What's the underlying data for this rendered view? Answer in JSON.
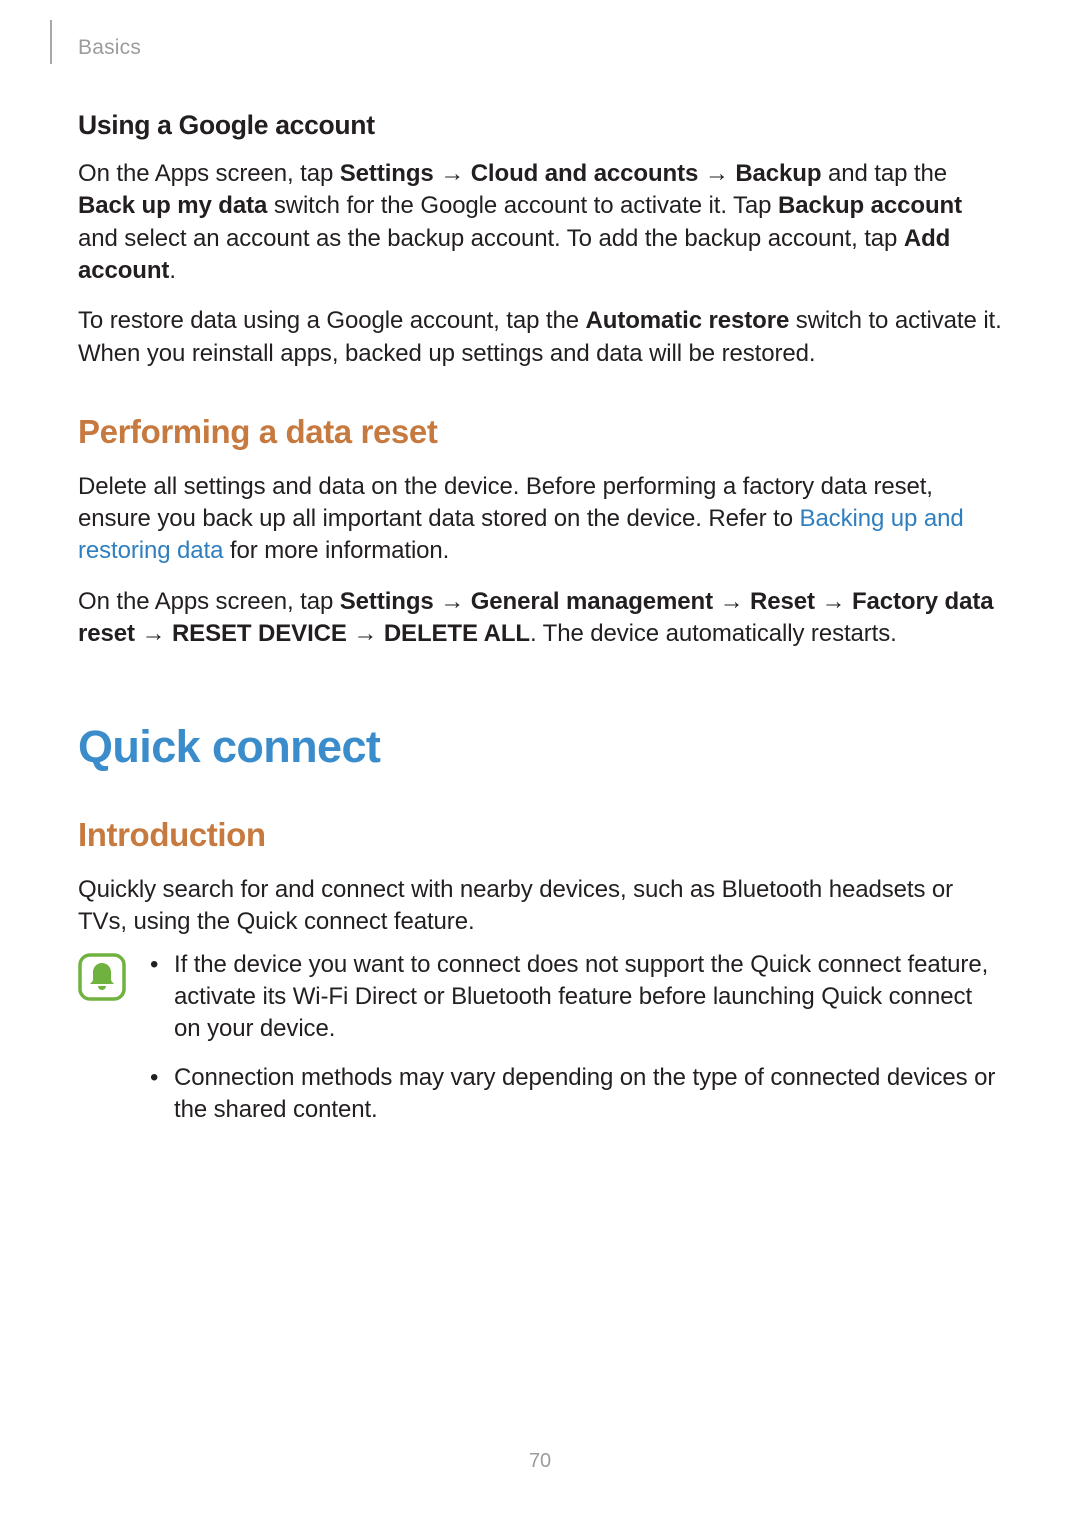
{
  "header": {
    "breadcrumb": "Basics"
  },
  "googleAccount": {
    "heading": "Using a Google account",
    "p1_parts": {
      "t0": "On the Apps screen, tap ",
      "b1": "Settings",
      "a1": " → ",
      "b2": "Cloud and accounts",
      "a2": " → ",
      "b3": "Backup",
      "t1": " and tap the ",
      "b4": "Back up my data",
      "t2": " switch for the Google account to activate it. Tap ",
      "b5": "Backup account",
      "t3": " and select an account as the backup account. To add the backup account, tap ",
      "b6": "Add account",
      "t4": "."
    },
    "p2_parts": {
      "t0": "To restore data using a Google account, tap the ",
      "b1": "Automatic restore",
      "t1": " switch to activate it. When you reinstall apps, backed up settings and data will be restored."
    }
  },
  "dataReset": {
    "heading": "Performing a data reset",
    "p1_parts": {
      "t0": "Delete all settings and data on the device. Before performing a factory data reset, ensure you back up all important data stored on the device. Refer to ",
      "link": "Backing up and restoring data",
      "t1": " for more information."
    },
    "p2_parts": {
      "t0": "On the Apps screen, tap ",
      "b1": "Settings",
      "a1": " → ",
      "b2": "General management",
      "a2": " → ",
      "b3": "Reset",
      "a3": " → ",
      "b4": "Factory data reset",
      "a4": " → ",
      "b5": "RESET DEVICE",
      "a5": " → ",
      "b6": "DELETE ALL",
      "t1": ". The device automatically restarts."
    }
  },
  "quickConnect": {
    "title": "Quick connect",
    "introHeading": "Introduction",
    "introText": "Quickly search for and connect with nearby devices, such as Bluetooth headsets or TVs, using the Quick connect feature.",
    "notes": [
      "If the device you want to connect does not support the Quick connect feature, activate its Wi-Fi Direct or Bluetooth feature before launching Quick connect on your device.",
      "Connection methods may vary depending on the type of connected devices or the shared content."
    ]
  },
  "pageNumber": "70",
  "icons": {
    "note": "note-bell-icon"
  }
}
